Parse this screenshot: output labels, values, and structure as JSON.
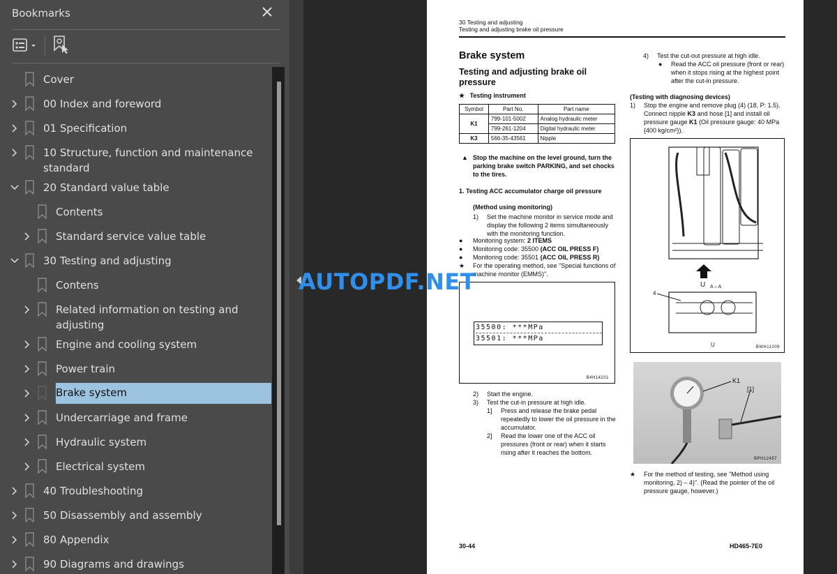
{
  "sidebar": {
    "title": "Bookmarks",
    "close_icon": "close-icon",
    "toolbar": {
      "options_icon": "list-options-icon",
      "find_bookmark_icon": "bookmark-find-icon"
    },
    "items": [
      {
        "label": "Cover",
        "level": 0,
        "expander": "none"
      },
      {
        "label": "00 Index and foreword",
        "level": 0,
        "expander": "collapsed"
      },
      {
        "label": "01 Specification",
        "level": 0,
        "expander": "collapsed"
      },
      {
        "label": "10 Structure, function and maintenance standard",
        "level": 0,
        "expander": "collapsed"
      },
      {
        "label": "20 Standard value table",
        "level": 0,
        "expander": "expanded"
      },
      {
        "label": "Contents",
        "level": 1,
        "expander": "none"
      },
      {
        "label": "Standard service value table",
        "level": 1,
        "expander": "collapsed"
      },
      {
        "label": "30 Testing and adjusting",
        "level": 0,
        "expander": "expanded"
      },
      {
        "label": "Contens",
        "level": 1,
        "expander": "none"
      },
      {
        "label": "Related information on testing and adjusting",
        "level": 1,
        "expander": "collapsed"
      },
      {
        "label": "Engine and cooling system",
        "level": 1,
        "expander": "collapsed"
      },
      {
        "label": "Power train",
        "level": 1,
        "expander": "collapsed"
      },
      {
        "label": "Brake system",
        "level": 1,
        "expander": "collapsed",
        "selected": true
      },
      {
        "label": "Undercarriage and frame",
        "level": 1,
        "expander": "collapsed"
      },
      {
        "label": "Hydraulic system",
        "level": 1,
        "expander": "collapsed"
      },
      {
        "label": "Electrical system",
        "level": 1,
        "expander": "collapsed"
      },
      {
        "label": "40 Troubleshooting",
        "level": 0,
        "expander": "collapsed"
      },
      {
        "label": "50 Disassembly and assembly",
        "level": 0,
        "expander": "collapsed"
      },
      {
        "label": "80 Appendix",
        "level": 0,
        "expander": "collapsed"
      },
      {
        "label": "90 Diagrams and drawings",
        "level": 0,
        "expander": "collapsed"
      }
    ],
    "selected_color": "#9cc3df"
  },
  "watermark": "AUTOPDF.NET",
  "page": {
    "header_line1": "30 Testing and adjusting",
    "header_line2": "Testing and adjusting brake oil pressure",
    "section_title": "Brake system",
    "subsection_title": "Testing and adjusting brake oil pressure",
    "instrument_label": "Testing instrument",
    "table": {
      "headers": [
        "Symbol",
        "Part No.",
        "Part name"
      ],
      "rows": [
        {
          "symbol": "K1",
          "part_no": "799-101-5002",
          "part_name": "Analog hydraulic meter"
        },
        {
          "symbol": "",
          "part_no": "799-261-1204",
          "part_name": "Digital hydraulic meter"
        },
        {
          "symbol": "K3",
          "part_no": "566-35-43561",
          "part_name": "Nipple"
        }
      ]
    },
    "warning": "Stop the machine on the level ground, turn the parking brake switch PARKING, and set chocks to the tires.",
    "step1_title": "1.   Testing ACC accumulator charge oil pressure",
    "step1_method": "(Method using monitoring)",
    "step1_1": "Set the machine monitor in service mode and display the following 2 items simultaneously with the monitoring function.",
    "bullets": [
      {
        "prefix": "Monitoring system: ",
        "bold": "2 ITEMS"
      },
      {
        "prefix": "Monitoring code: 35500 ",
        "bold": "(ACC OIL PRESS F)"
      },
      {
        "prefix": "Monitoring code: 35501 ",
        "bold": "(ACC OIL PRESS R)"
      }
    ],
    "star_note1": "For the operating method, see \"Special functions of machine monitor (EMMS)\".",
    "lcd_lines": [
      "35500: ***MPa",
      "35501: ***MPa"
    ],
    "fig1_code": "B4H14201",
    "step2": "Start the engine.",
    "step3": "Test the cut-in pressure at high idle.",
    "step3_1": "Press and release the brake pedal repeatedly to lower the oil pressure in the accumulator.",
    "step3_2": "Read the lower one of the ACC oil pressures (front or rear) when it starts rising after it reaches the bottom.",
    "step4": "Test the cut-out pressure at high idle.",
    "step4_bullet": "Read the ACC oil pressure (front or rear) when it stops rising at the highest point after the cut-in pressure.",
    "diag_title": "(Testing with diagnosing devices)",
    "diag_1_parts": [
      "Stop the engine and remove plug (4) (18, P: 1.5).  Connect nipple ",
      "K3",
      " and hose [1] and install oil pressure gauge ",
      "K1",
      " (Oil pressure gauge: 40 MPa {400 kg/cm²})."
    ],
    "fig2_labels": {
      "view": "A – A",
      "part": "4",
      "code": "BWH11009"
    },
    "fig3_labels": {
      "k1": "K1",
      "hose": "[1]",
      "code": "BPH12457"
    },
    "star_note2": "For the method of testing, see \"Method using monitoring, 2) – 4)\".  (Read the pointer of the oil pressure gauge, however.)",
    "footer_left": "30-44",
    "footer_right": "HD465-7E0"
  }
}
